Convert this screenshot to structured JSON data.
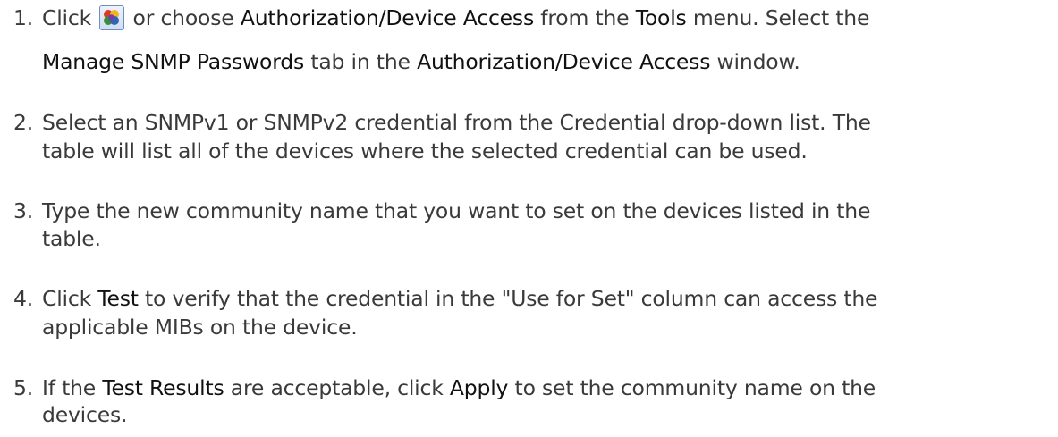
{
  "steps": [
    {
      "number": "1.",
      "lines": [
        [
          "Click ",
          {
            "icon": "authorization-device-access-icon"
          },
          " or choose ",
          {
            "ui": "Authorization/Device Access"
          },
          " from the ",
          {
            "ui": "Tools"
          },
          " menu. Select the"
        ],
        [
          {
            "ui": "Manage SNMP Passwords"
          },
          " tab in the ",
          {
            "ui": "Authorization/Device Access"
          },
          " window."
        ]
      ]
    },
    {
      "number": "2.",
      "lines": [
        [
          "Select an SNMPv1 or SNMPv2 credential from the Credential drop-down list. The"
        ],
        [
          "table will list all of the devices where the selected credential can be used."
        ]
      ]
    },
    {
      "number": "3.",
      "lines": [
        [
          "Type the new community name that you want to set on the devices listed in the"
        ],
        [
          "table."
        ]
      ]
    },
    {
      "number": "4.",
      "lines": [
        [
          "Click ",
          {
            "ui": "Test"
          },
          " to verify that the credential in the \"Use for Set\" column can access the"
        ],
        [
          "applicable MIBs on the device."
        ]
      ]
    },
    {
      "number": "5.",
      "lines": [
        [
          "If the ",
          {
            "ui": "Test Results"
          },
          " are acceptable, click ",
          {
            "ui": "Apply"
          },
          " to set the community name on the"
        ],
        [
          "devices."
        ]
      ]
    }
  ]
}
